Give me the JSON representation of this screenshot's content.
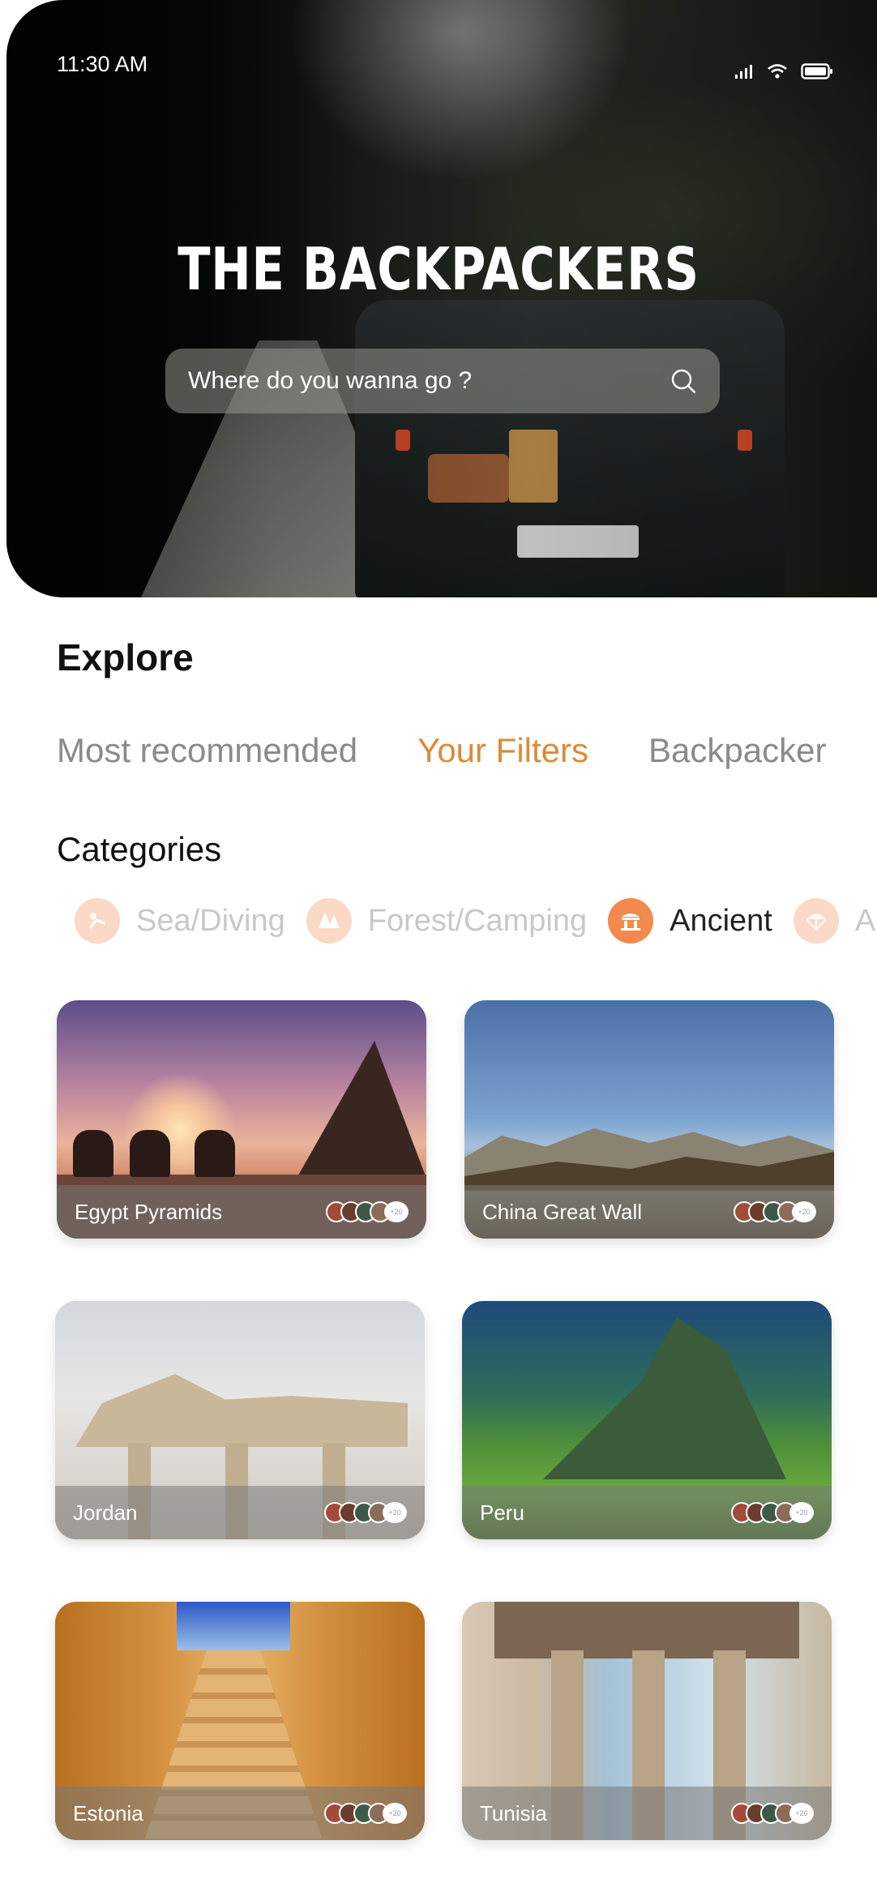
{
  "status_bar": {
    "time": "11:30 AM"
  },
  "app": {
    "title": "THE BACKPACKERS"
  },
  "search": {
    "placeholder": "Where do you wanna go ?"
  },
  "explore": {
    "heading": "Explore",
    "tabs": [
      {
        "label": "Most recommended",
        "active": false
      },
      {
        "label": "Your Filters",
        "active": true
      },
      {
        "label": "Backpacker",
        "active": false
      }
    ]
  },
  "categories": {
    "heading": "Categories",
    "items": [
      {
        "label": "Sea/Diving",
        "icon": "diver-icon",
        "active": false
      },
      {
        "label": "Forest/Camping",
        "icon": "tree-icon",
        "active": false
      },
      {
        "label": "Ancient",
        "icon": "temple-icon",
        "active": true
      },
      {
        "label": "A",
        "icon": "parachute-icon",
        "active": false
      }
    ]
  },
  "destinations": [
    {
      "name": "Egypt Pyramids",
      "count": "+20"
    },
    {
      "name": "China Great Wall",
      "count": "+20"
    },
    {
      "name": "Jordan",
      "count": "+20"
    },
    {
      "name": "Peru",
      "count": "+20"
    },
    {
      "name": "Estonia",
      "count": "+20"
    },
    {
      "name": "Tunisia",
      "count": "+20"
    }
  ],
  "colors": {
    "accent": "#d98c3a",
    "category_active": "#f28a4e",
    "category_inactive": "#fbd9c7"
  }
}
